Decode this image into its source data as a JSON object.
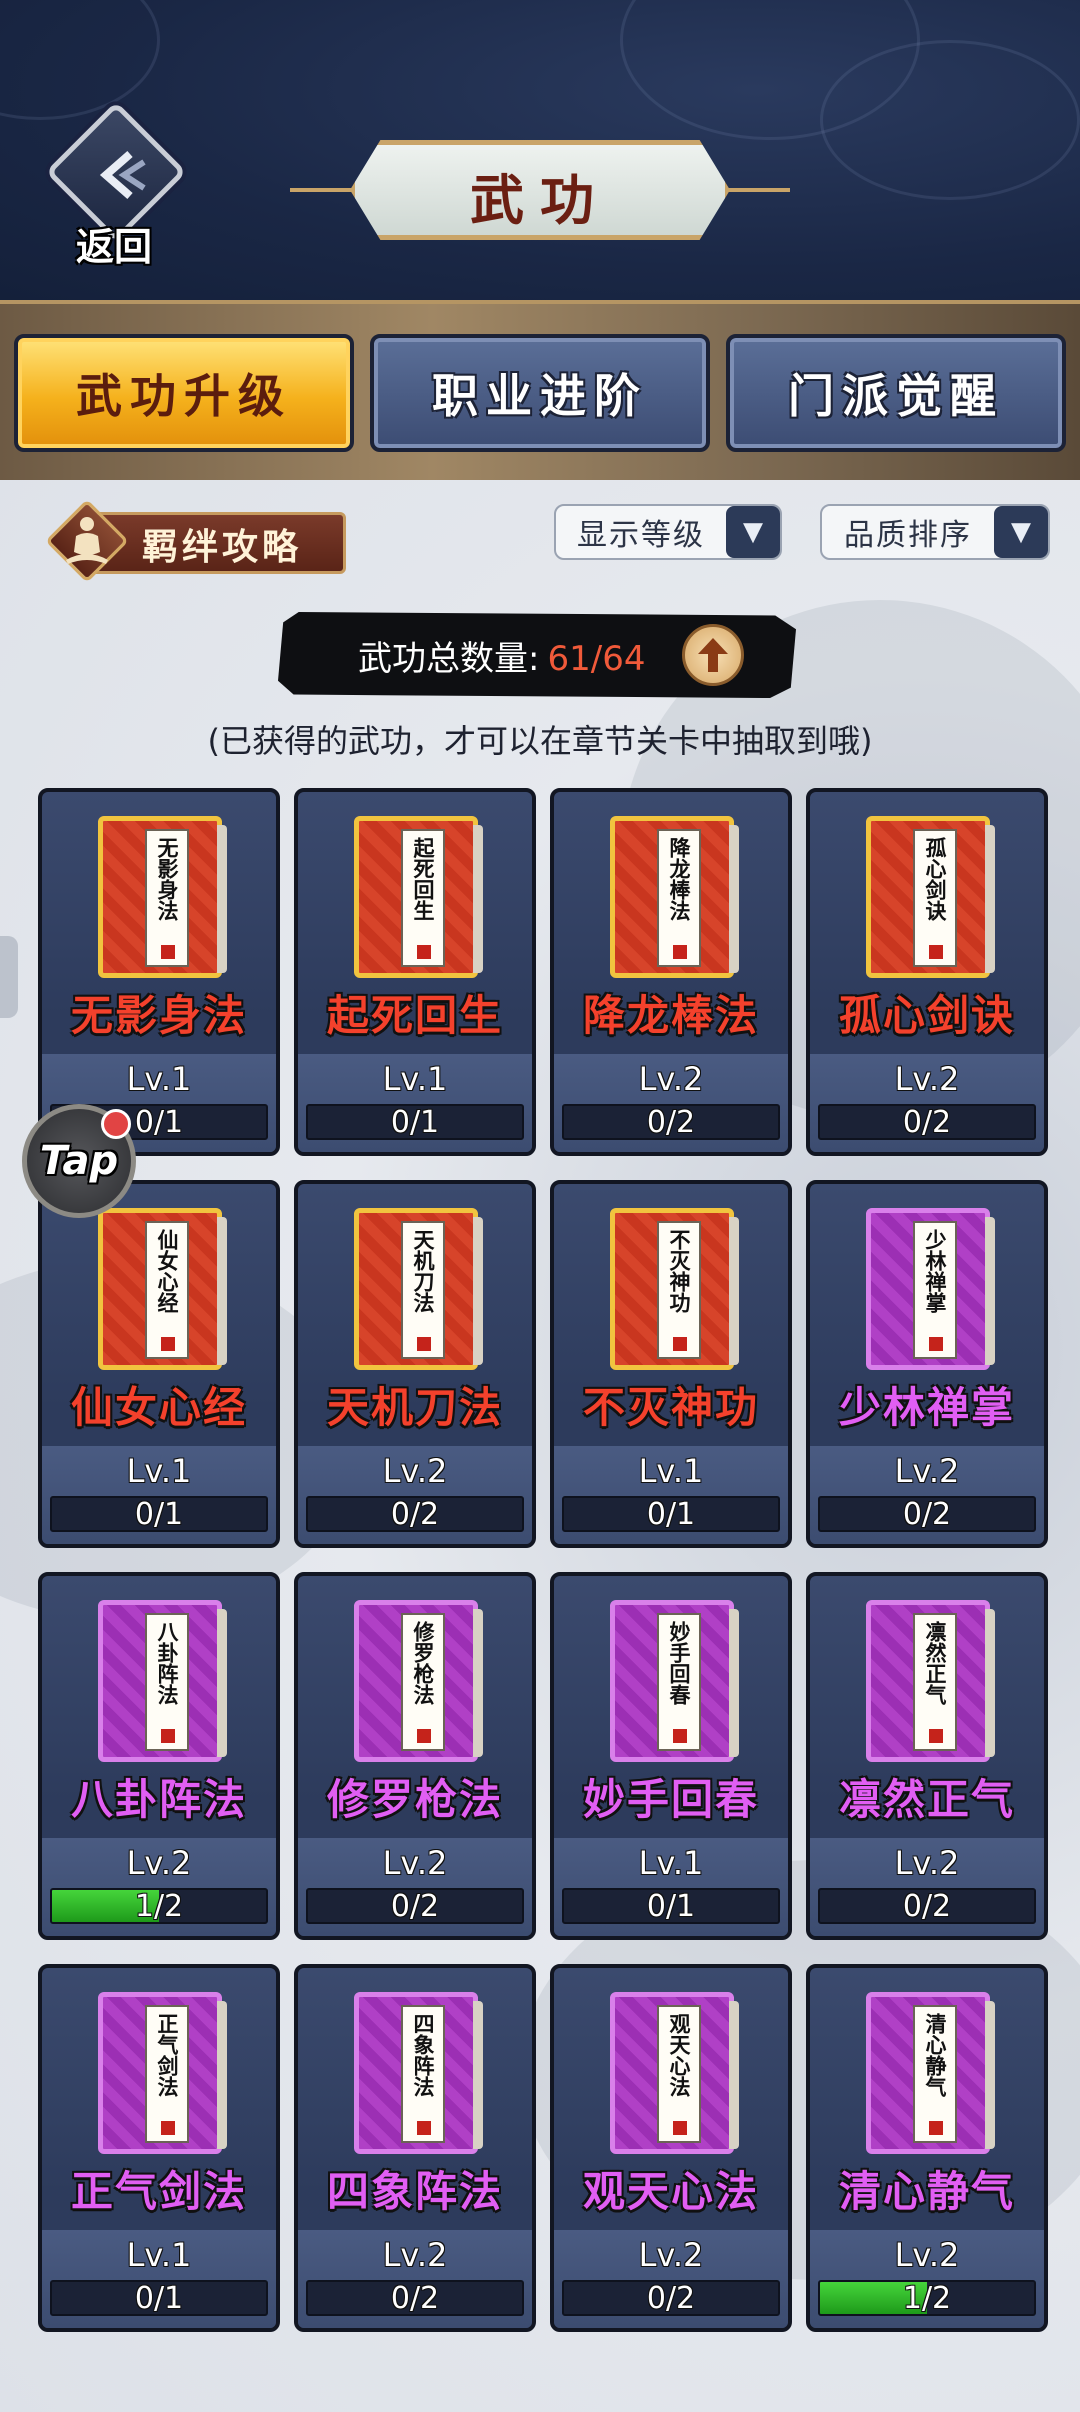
{
  "header": {
    "back_label": "返回",
    "title": "武功"
  },
  "tabs": [
    {
      "label": "武功升级",
      "active": true
    },
    {
      "label": "职业进阶",
      "active": false
    },
    {
      "label": "门派觉醒",
      "active": false
    }
  ],
  "toolbar": {
    "bond_label": "羁绊攻略",
    "dropdown_level": "显示等级",
    "dropdown_quality": "品质排序"
  },
  "summary": {
    "label": "武功总数量:",
    "value": "61/64",
    "hint": "(已获得的武功，才可以在章节关卡中抽取到哦)"
  },
  "colors": {
    "red_rarity": "#f4412c",
    "purple_rarity": "#e15ef3",
    "active_tab": "#f5b11c"
  },
  "skills": [
    {
      "name": "无影身法",
      "level": "Lv.1",
      "progress": "0/1",
      "fill": 0,
      "rarity": "red"
    },
    {
      "name": "起死回生",
      "level": "Lv.1",
      "progress": "0/1",
      "fill": 0,
      "rarity": "red"
    },
    {
      "name": "降龙棒法",
      "level": "Lv.2",
      "progress": "0/2",
      "fill": 0,
      "rarity": "red"
    },
    {
      "name": "孤心剑诀",
      "level": "Lv.2",
      "progress": "0/2",
      "fill": 0,
      "rarity": "red"
    },
    {
      "name": "仙女心经",
      "level": "Lv.1",
      "progress": "0/1",
      "fill": 0,
      "rarity": "red"
    },
    {
      "name": "天机刀法",
      "level": "Lv.2",
      "progress": "0/2",
      "fill": 0,
      "rarity": "red"
    },
    {
      "name": "不灭神功",
      "level": "Lv.1",
      "progress": "0/1",
      "fill": 0,
      "rarity": "red"
    },
    {
      "name": "少林禅掌",
      "level": "Lv.2",
      "progress": "0/2",
      "fill": 0,
      "rarity": "purple"
    },
    {
      "name": "八卦阵法",
      "level": "Lv.2",
      "progress": "1/2",
      "fill": 0.5,
      "rarity": "purple"
    },
    {
      "name": "修罗枪法",
      "level": "Lv.2",
      "progress": "0/2",
      "fill": 0,
      "rarity": "purple"
    },
    {
      "name": "妙手回春",
      "level": "Lv.1",
      "progress": "0/1",
      "fill": 0,
      "rarity": "purple"
    },
    {
      "name": "凛然正气",
      "level": "Lv.2",
      "progress": "0/2",
      "fill": 0,
      "rarity": "purple"
    },
    {
      "name": "正气剑法",
      "level": "Lv.1",
      "progress": "0/1",
      "fill": 0,
      "rarity": "purple"
    },
    {
      "name": "四象阵法",
      "level": "Lv.2",
      "progress": "0/2",
      "fill": 0,
      "rarity": "purple"
    },
    {
      "name": "观天心法",
      "level": "Lv.2",
      "progress": "0/2",
      "fill": 0,
      "rarity": "purple"
    },
    {
      "name": "清心静气",
      "level": "Lv.2",
      "progress": "1/2",
      "fill": 0.5,
      "rarity": "purple"
    }
  ],
  "tap_button": {
    "label": "Tap",
    "icon": "tap-icon"
  }
}
